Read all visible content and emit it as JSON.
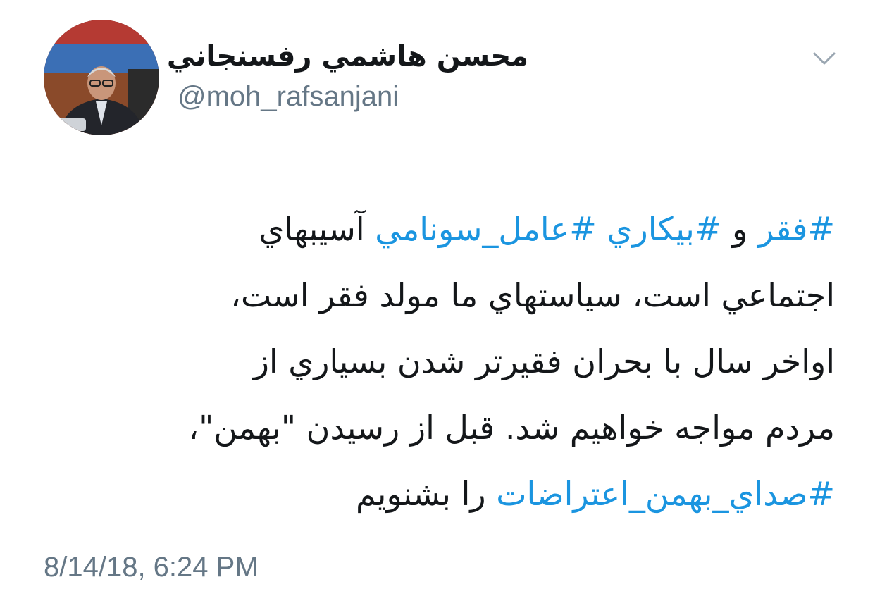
{
  "author": {
    "display_name": "محسن هاشمي رفسنجاني",
    "handle": "@moh_rafsanjani",
    "avatar_icon": "profile-photo"
  },
  "menu": {
    "icon": "chevron-down-icon"
  },
  "tweet": {
    "line1": {
      "hashtag1": "#فقر",
      "text1": " و ",
      "hashtag2": "#بيكاري",
      "text2": " ",
      "hashtag3": "#عامل_سونامي",
      "text3": " آسيبهاي"
    },
    "line2": "اجتماعي است، سياستهاي ما مولد فقر است،",
    "line3": "اواخر سال با بحران فقيرتر شدن بسياري از",
    "line4": "مردم مواجه خواهيم شد. قبل از رسيدن \"بهمن\"،",
    "line5": {
      "hashtag": "#صداي_بهمن_اعتراضات",
      "text": " را بشنويم"
    },
    "timestamp": "8/14/18, 6:24 PM"
  },
  "colors": {
    "text": "#14171a",
    "secondary": "#657786",
    "link": "#1b95e0",
    "background": "#ffffff"
  }
}
